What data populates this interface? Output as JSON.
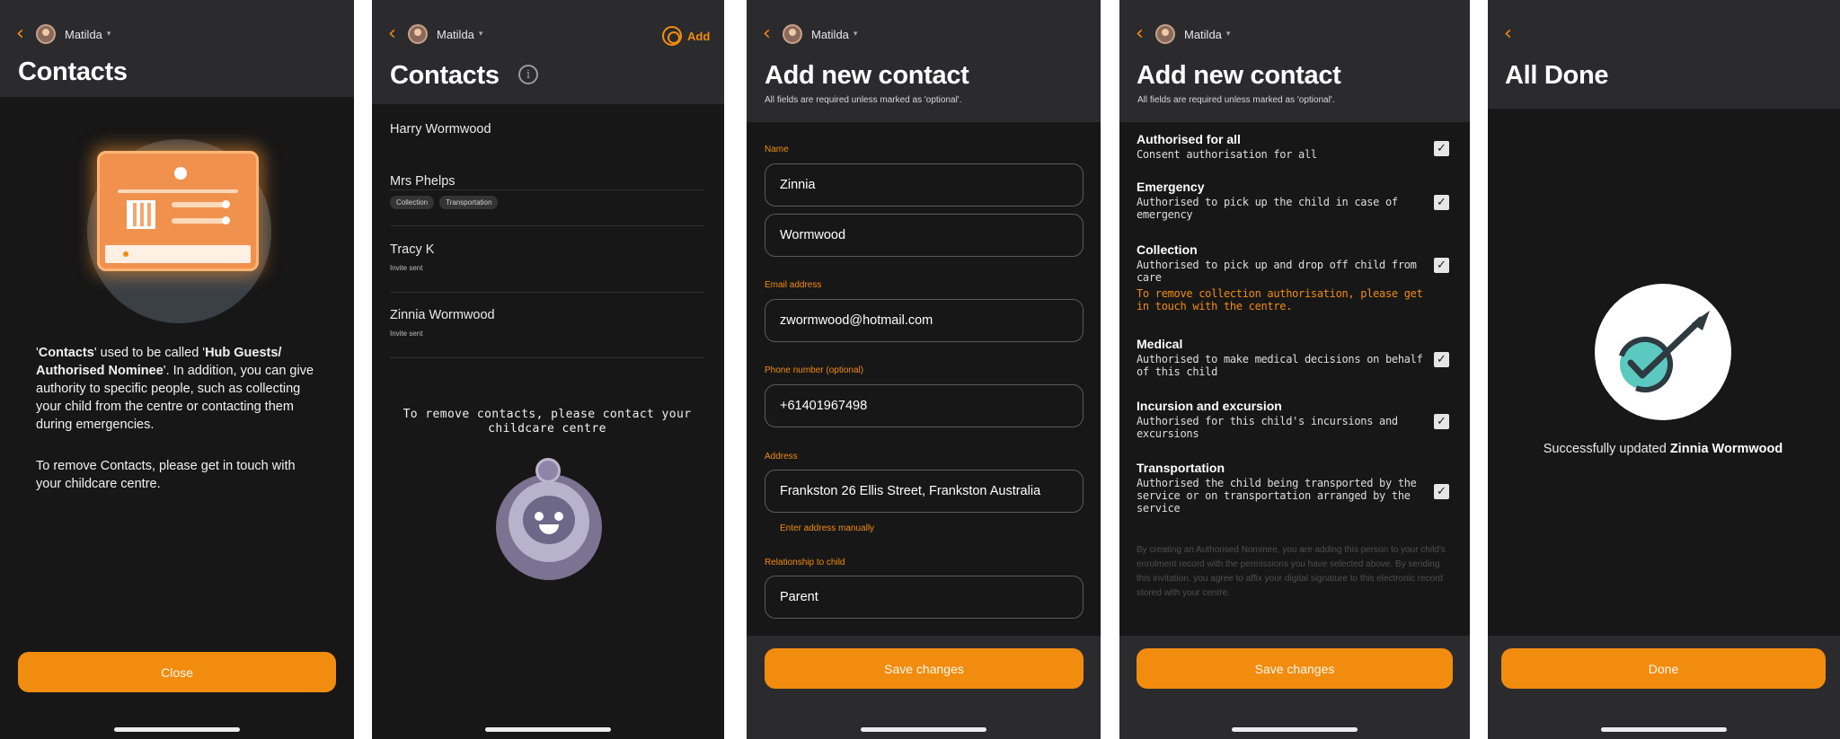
{
  "accent": "#f28c0f",
  "user": {
    "name": "Matilda"
  },
  "screen1": {
    "title": "Contacts",
    "para1": {
      "q1": "'",
      "b1": "Contacts",
      "t1": "' used to be called '",
      "b2": "Hub Guests/ Authorised Nominee",
      "t2": "'. In addition, you can give authority to specific people, such as collecting your child from the centre or contacting them during emergencies."
    },
    "para2": "To remove Contacts, please get in touch with your childcare centre.",
    "button": "Close"
  },
  "screen2": {
    "title": "Contacts",
    "info_icon": "info-icon",
    "add_label": "Add",
    "contacts": [
      {
        "name": "Harry Wormwood"
      },
      {
        "name": "Mrs Phelps",
        "tags": [
          "Collection",
          "Transportation"
        ]
      },
      {
        "name": "Tracy K",
        "status": "Invite sent"
      },
      {
        "name": "Zinnia Wormwood",
        "status": "Invite sent"
      }
    ],
    "note": "To remove contacts, please contact your childcare centre"
  },
  "screen3": {
    "title": "Add new contact",
    "subtitle": "All fields are required unless marked as 'optional'.",
    "name_label": "Name",
    "first_name": "Zinnia",
    "last_name": "Wormwood",
    "email_label": "Email address",
    "email": "zwormwood@hotmail.com",
    "phone_label": "Phone number (optional)",
    "phone": "+61401967498",
    "address_label": "Address",
    "address": "Frankston 26 Ellis Street, Frankston Australia",
    "address_link": "Enter address manually",
    "relationship_label": "Relationship to child",
    "relationship": "Parent",
    "button": "Save changes"
  },
  "screen4": {
    "title": "Add new contact",
    "subtitle": "All fields are required unless marked as 'optional'.",
    "permissions": [
      {
        "title": "Authorised for all",
        "desc": "Consent authorisation for all",
        "checked": true
      },
      {
        "title": "Emergency",
        "desc": "Authorised to pick up the child in case of emergency",
        "checked": true
      },
      {
        "title": "Collection",
        "desc": "Authorised to pick up and drop off child from care",
        "warning": "To remove collection authorisation, please get in touch with the centre.",
        "checked": true
      },
      {
        "title": "Medical",
        "desc": "Authorised to make medical decisions on behalf of this child",
        "checked": true
      },
      {
        "title": "Incursion and excursion",
        "desc": "Authorised for this child's incursions and excursions",
        "checked": true
      },
      {
        "title": "Transportation",
        "desc": "Authorised the child being transported by the service or on transportation arranged by the service",
        "checked": true
      }
    ],
    "check_glyph": "✓",
    "disclaimer": "By creating an Authorised Nominee, you are adding this person to your child's enrolment record with the permissions you have selected above. By sending this invitation, you agree to affix your digital signature to this electronic record stored with your centre.",
    "button": "Save changes"
  },
  "screen5": {
    "title": "All Done",
    "success_prefix": "Successfully updated ",
    "success_name": "Zinnia Wormwood",
    "button": "Done",
    "icon": "rocket-check-icon"
  }
}
